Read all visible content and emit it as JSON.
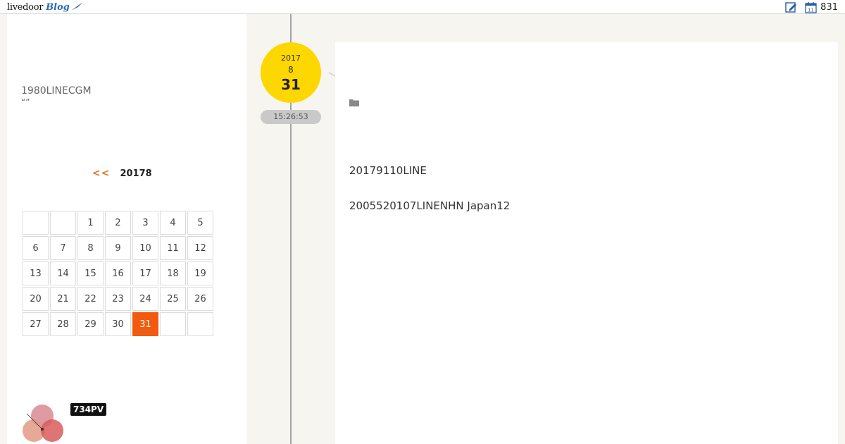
{
  "header": {
    "logo_text": "livedoor",
    "logo_blog": "Blog",
    "pv_count": "831",
    "icons": [
      "edit-icon",
      "calendar-icon"
    ]
  },
  "sidebar": {
    "blog_title": "1980LINECGM",
    "blog_desc": "“”",
    "calendar": {
      "prev_label": "<<",
      "month_label": "20178",
      "weeks": [
        [
          "",
          "",
          "1",
          "2",
          "3",
          "4",
          "5"
        ],
        [
          "6",
          "7",
          "8",
          "9",
          "10",
          "11",
          "12"
        ],
        [
          "13",
          "14",
          "15",
          "16",
          "17",
          "18",
          "19"
        ],
        [
          "20",
          "21",
          "22",
          "23",
          "24",
          "25",
          "26"
        ],
        [
          "27",
          "28",
          "29",
          "30",
          "31",
          "",
          ""
        ]
      ],
      "highlighted_day": "31",
      "highlight_color": "#f25a0f"
    },
    "ranking": {
      "pv_badge": "734PV"
    }
  },
  "post": {
    "date": {
      "year": "2017",
      "month": "8",
      "day": "31"
    },
    "time": "15:26:53",
    "date_circle_color": "#fdd800",
    "paragraphs": [
      "20179110LINE",
      "2005520107LINENHN Japan12"
    ]
  }
}
